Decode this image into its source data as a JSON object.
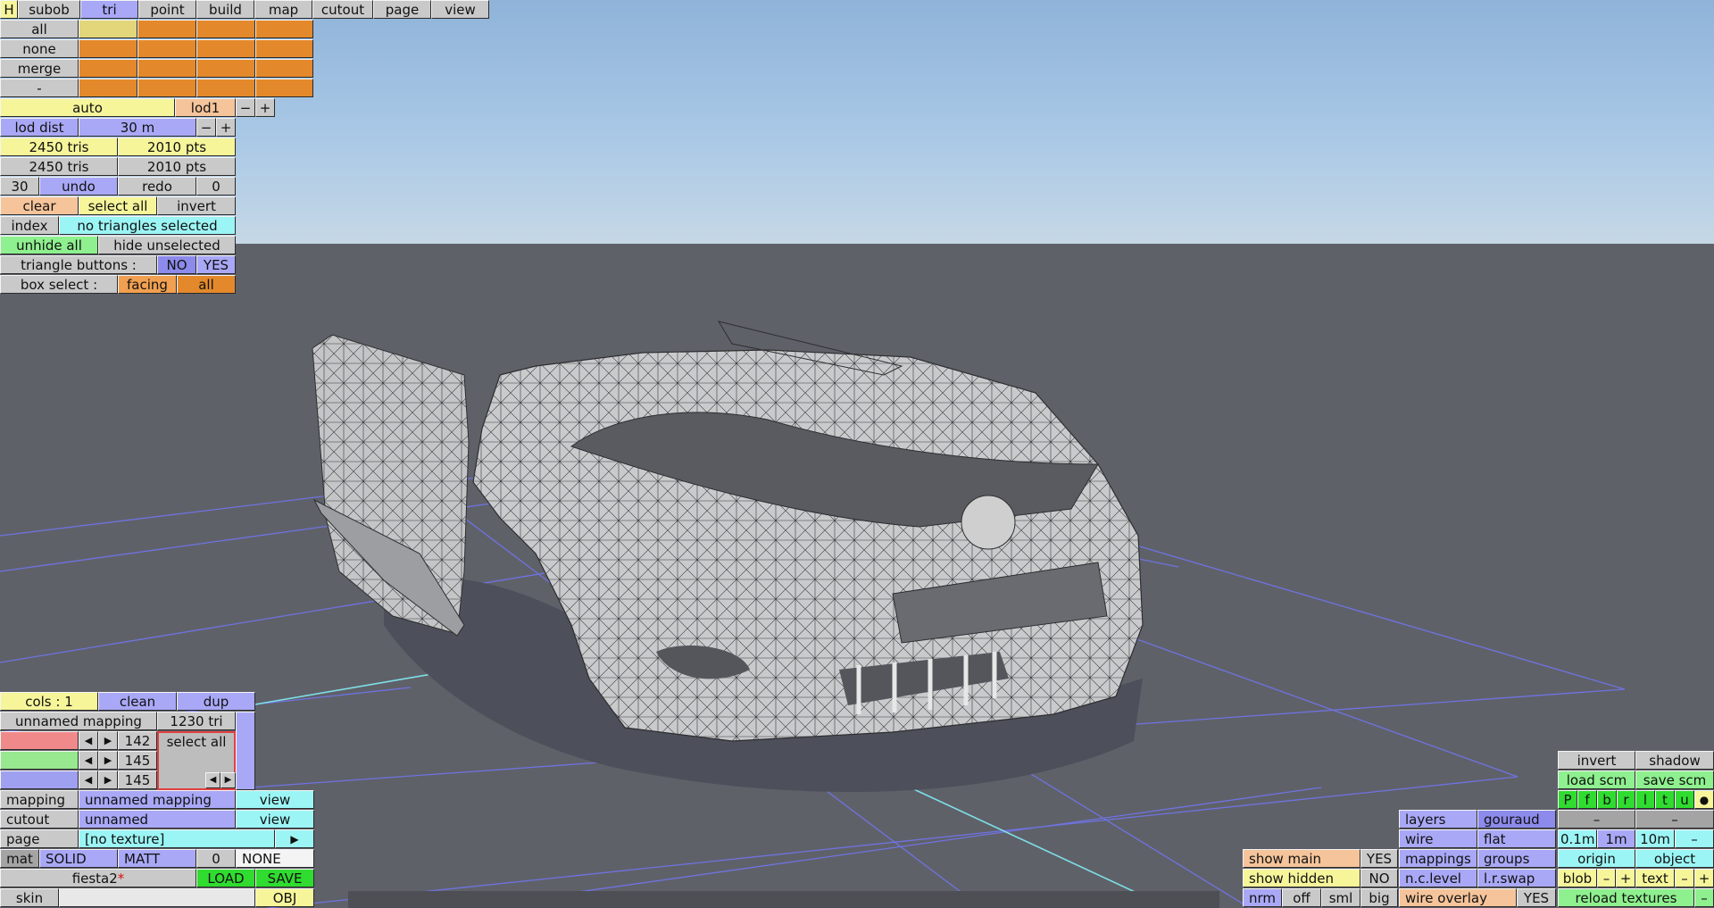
{
  "menu": {
    "h": "H",
    "subob": "subob",
    "tri": "tri",
    "point": "point",
    "build": "build",
    "map": "map",
    "cutout": "cutout",
    "page": "page",
    "view": "view"
  },
  "select": {
    "all": "all",
    "none": "none",
    "merge": "merge",
    "minus": "-"
  },
  "lod": {
    "auto": "auto",
    "level": "lod1",
    "minus": "−",
    "plus": "+",
    "dist_label": "lod dist",
    "dist_value": "30 m"
  },
  "counts": {
    "tris_a": "2450 tris",
    "pts_a": "2010 pts",
    "tris_b": "2450 tris",
    "pts_b": "2010 pts"
  },
  "history": {
    "undo_count": "30",
    "undo": "undo",
    "redo": "redo",
    "redo_count": "0"
  },
  "tri_ops": {
    "clear": "clear",
    "select_all": "select all",
    "invert": "invert",
    "index": "index",
    "status": "no triangles selected",
    "unhide_all": "unhide all",
    "hide_unselected": "hide unselected",
    "triangle_buttons": "triangle buttons :",
    "no": "NO",
    "yes": "YES",
    "box_select": "box select :",
    "facing": "facing",
    "all": "all"
  },
  "mapping_panel": {
    "cols": "cols : 1",
    "clean": "clean",
    "dup": "dup",
    "mapping_name": "unnamed mapping",
    "mapping_tris": "1230 tri",
    "r_value": "142",
    "g_value": "145",
    "b_value": "145",
    "select_all": "select all",
    "left_arrow": "◀",
    "right_arrow": "▶"
  },
  "props": {
    "mapping_label": "mapping",
    "mapping_value": "unnamed mapping",
    "view1": "view",
    "cutout_label": "cutout",
    "cutout_value": "unnamed",
    "view2": "view",
    "page_label": "page",
    "page_value": "[no texture]",
    "page_arrow": "▶",
    "mat_label": "mat",
    "solid": "SOLID",
    "matt": "MATT",
    "mat_num": "0",
    "none": "NONE",
    "file_name": "fiesta2",
    "file_mark": "*",
    "load": "LOAD",
    "save": "SAVE",
    "skin": "skin",
    "obj": "OBJ"
  },
  "view_panel": {
    "invert": "invert",
    "shadow": "shadow",
    "load_scm": "load scm",
    "save_scm": "save scm",
    "flags": [
      "P",
      "f",
      "b",
      "r",
      "l",
      "t",
      "u"
    ],
    "dot": "●",
    "dash1": "–",
    "dash2": "–",
    "layers": "layers",
    "gouraud": "gouraud",
    "wire": "wire",
    "flat": "flat",
    "d01": "0.1m",
    "d1": "1m",
    "d10": "10m",
    "dminus": "–",
    "show_main": "show main",
    "show_main_val": "YES",
    "mappings": "mappings",
    "groups": "groups",
    "origin": "origin",
    "object": "object",
    "show_hidden": "show hidden",
    "show_hidden_val": "NO",
    "nclevel": "n.c.level",
    "lrswap": "l.r.swap",
    "blob": "blob",
    "bminus": "–",
    "bplus": "+",
    "text": "text",
    "tminus": "–",
    "tplus": "+",
    "nrm": "nrm",
    "off": "off",
    "sml": "sml",
    "big": "big",
    "wire_overlay": "wire overlay",
    "wire_overlay_val": "YES",
    "reload": "reload textures",
    "rminus": "–"
  },
  "colors": {
    "sky": "#a9c8e6",
    "ground": "#5f6169",
    "grid": "#6f73e0",
    "cyan_line": "#7fe0e8",
    "car": "#c9cacc",
    "car_shade": "#a9aaac"
  }
}
